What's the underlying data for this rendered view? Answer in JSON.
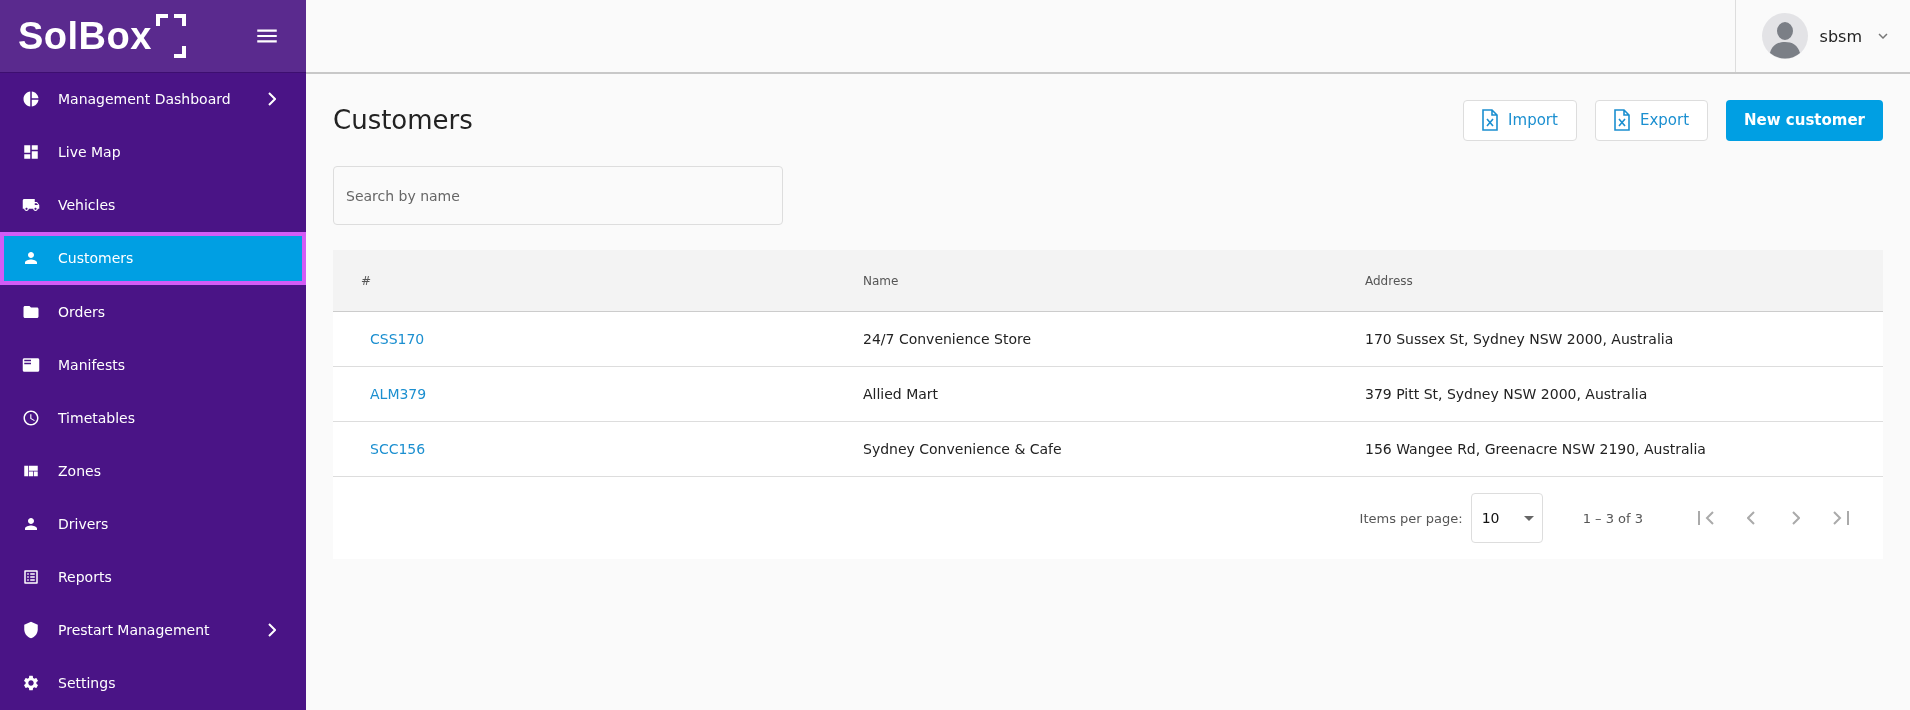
{
  "brand": {
    "logo": "SolBox"
  },
  "sidebar": {
    "items": [
      {
        "label": "Management Dashboard",
        "selected": false,
        "has_submenu": true
      },
      {
        "label": "Live Map",
        "selected": false,
        "has_submenu": false
      },
      {
        "label": "Vehicles",
        "selected": false,
        "has_submenu": false
      },
      {
        "label": "Customers",
        "selected": true,
        "has_submenu": false
      },
      {
        "label": "Orders",
        "selected": false,
        "has_submenu": false
      },
      {
        "label": "Manifests",
        "selected": false,
        "has_submenu": false
      },
      {
        "label": "Timetables",
        "selected": false,
        "has_submenu": false
      },
      {
        "label": "Zones",
        "selected": false,
        "has_submenu": false
      },
      {
        "label": "Drivers",
        "selected": false,
        "has_submenu": false
      },
      {
        "label": "Reports",
        "selected": false,
        "has_submenu": false
      },
      {
        "label": "Prestart Management",
        "selected": false,
        "has_submenu": true
      },
      {
        "label": "Settings",
        "selected": false,
        "has_submenu": false
      }
    ]
  },
  "user": {
    "name": "sbsm"
  },
  "page": {
    "title": "Customers",
    "actions": [
      {
        "label": "Import",
        "kind": "file"
      },
      {
        "label": "Export",
        "kind": "file"
      },
      {
        "label": "New customer",
        "kind": "primary"
      }
    ]
  },
  "search": {
    "placeholder": "Search by name"
  },
  "table": {
    "columns": [
      "#",
      "Name",
      "Address"
    ],
    "rows": [
      [
        "CSS170",
        "24/7 Convenience Store",
        "170 Sussex St, Sydney NSW 2000, Australia"
      ],
      [
        "ALM379",
        "Allied Mart",
        "379 Pitt St, Sydney NSW 2000, Australia"
      ],
      [
        "SCC156",
        "Sydney Convenience & Cafe",
        "156 Wangee Rd, Greenacre NSW 2190, Australia"
      ]
    ]
  },
  "paginator": {
    "label": "Items per page:",
    "page_size": "10",
    "range": "1 – 3 of 3"
  }
}
